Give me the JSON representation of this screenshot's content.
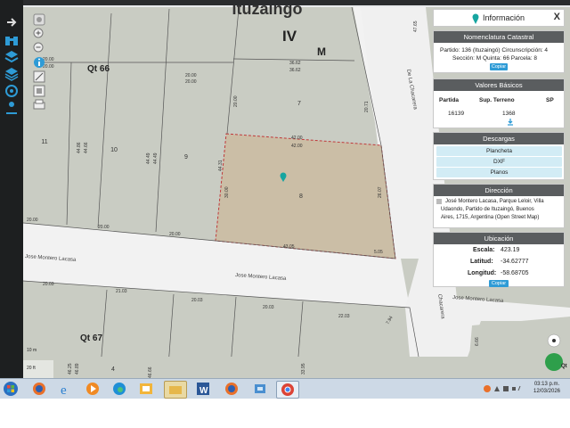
{
  "map": {
    "labels": {
      "barrio": "Ituzaingo",
      "circ": "IV",
      "section": "M",
      "qt66": "Qt 66",
      "qt67": "Qt 67",
      "street_h1": "Jose Montero Lacasa",
      "street_h2": "Jose Montero Lacasa",
      "street_h3": "Jose Montero Lacasa",
      "street_v1": "De La Chacarera",
      "street_v2": "Chacarera",
      "scale": "10 m",
      "scale2": "20 ft",
      "qt_right": "Qt"
    },
    "parcels": {
      "p7": "7",
      "p8": "8",
      "p9": "9",
      "p10": "10",
      "p11": "11",
      "p4": "4"
    },
    "dims": {
      "d36_62a": "36.62",
      "d36_62b": "36.62",
      "d20_00a": "20.00",
      "d20_00b": "20.00",
      "d20_00c": "20.00",
      "d20_00d": "20.00",
      "d20_00e": "20.00",
      "d20_00f": "20.00",
      "d20_00g": "20.00",
      "d42_00a": "42.00",
      "d42_00b": "42.00",
      "d44_86": "44.86",
      "d44_66": "44.66",
      "d44_49a": "44.49",
      "d44_49b": "44.49",
      "d44_31": "44.31",
      "d30_00": "30.00",
      "d26_07": "26.07",
      "d20_71": "20.71",
      "d43_05": "43.05",
      "d5_05": "5.05",
      "d47_65": "47.65",
      "d20_03a": "20.03",
      "d21_03": "21.03",
      "d20_03b": "20.03",
      "d20_03c": "20.03",
      "d22_03": "22.03",
      "d7_94": "7.94",
      "d6_66": "6.66",
      "d46_25": "46.25",
      "d46_89": "46.89",
      "d46_66": "46.66",
      "d33_95": "33.95"
    }
  },
  "panel": {
    "title": "Información",
    "close": "X",
    "nomenclatura": {
      "header": "Nomenclatura Catastral",
      "line1": "Partido: 136 (Ituzaingó) Circunscripción: 4",
      "line2": "Sección: M Quinta: 66 Parcela: 8",
      "copy": "Copiar"
    },
    "valores": {
      "header": "Valores Básicos",
      "col1": "Partida",
      "col2": "Sup. Terreno",
      "col3": "SP",
      "v1": "16139",
      "v2": "1368"
    },
    "descargas": {
      "header": "Descargas",
      "items": [
        "Plancheta",
        "DXF",
        "Planos"
      ]
    },
    "direccion": {
      "header": "Dirección",
      "text1": "José Montero Lacasa, Parque Leloir, Villa",
      "text2": "Udaondo, Partido de Ituzaingó, Buenos",
      "text3": "Aires, 1715, Argentina (Open Street Map)"
    },
    "ubicacion": {
      "header": "Ubicación",
      "escala_label": "Escala:",
      "escala_value": "423.19",
      "latitud_label": "Latitud:",
      "latitud_value": "-34.62777",
      "longitud_label": "Longitud:",
      "longitud_value": "-58.68705",
      "copy": "Copiar"
    }
  },
  "taskbar": {
    "time": "03:13 p.m.",
    "date": "12/03/2026"
  },
  "colors": {
    "map_bg": "#c8cdc4",
    "street": "#efefef",
    "parcel_sel": "#c9bda4",
    "accent": "#2e9bd6"
  }
}
